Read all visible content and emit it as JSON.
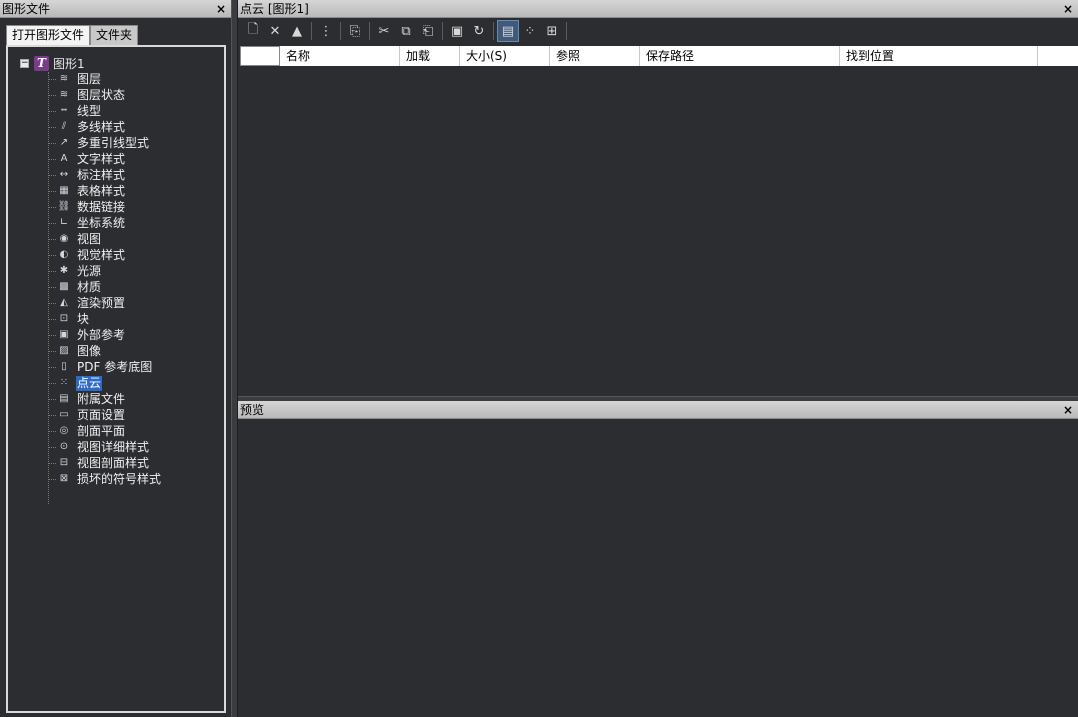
{
  "left_panel": {
    "title": "图形文件",
    "close": "×",
    "tabs": [
      "打开图形文件",
      "文件夹"
    ],
    "tree": {
      "root": {
        "expander": "−",
        "icon": "T",
        "label": "图形1"
      },
      "items": [
        {
          "icon": "layer-icon",
          "glyph": "≋",
          "label": "图层"
        },
        {
          "icon": "layer-state-icon",
          "glyph": "≋",
          "label": "图层状态"
        },
        {
          "icon": "linetype-icon",
          "glyph": "┅",
          "label": "线型"
        },
        {
          "icon": "multiline-style-icon",
          "glyph": "⫽",
          "label": "多线样式"
        },
        {
          "icon": "multileader-style-icon",
          "glyph": "↗",
          "label": "多重引线型式"
        },
        {
          "icon": "text-style-icon",
          "glyph": "A",
          "label": "文字样式"
        },
        {
          "icon": "dimension-style-icon",
          "glyph": "↔",
          "label": "标注样式"
        },
        {
          "icon": "table-style-icon",
          "glyph": "▦",
          "label": "表格样式"
        },
        {
          "icon": "data-link-icon",
          "glyph": "⛓",
          "label": "数据链接"
        },
        {
          "icon": "ucs-icon",
          "glyph": "∟",
          "label": "坐标系统"
        },
        {
          "icon": "view-icon",
          "glyph": "◉",
          "label": "视图"
        },
        {
          "icon": "visual-style-icon",
          "glyph": "◐",
          "label": "视觉样式"
        },
        {
          "icon": "light-icon",
          "glyph": "✱",
          "label": "光源"
        },
        {
          "icon": "material-icon",
          "glyph": "▩",
          "label": "材质"
        },
        {
          "icon": "render-preset-icon",
          "glyph": "◭",
          "label": "渲染预置"
        },
        {
          "icon": "block-icon",
          "glyph": "⊡",
          "label": "块"
        },
        {
          "icon": "xref-icon",
          "glyph": "▣",
          "label": "外部参考"
        },
        {
          "icon": "image-icon",
          "glyph": "▨",
          "label": "图像"
        },
        {
          "icon": "pdf-underlay-icon",
          "glyph": "▯",
          "label": "PDF 参考底图"
        },
        {
          "icon": "point-cloud-icon",
          "glyph": "⁙",
          "label": "点云",
          "selected": true
        },
        {
          "icon": "attached-file-icon",
          "glyph": "▤",
          "label": "附属文件"
        },
        {
          "icon": "page-setup-icon",
          "glyph": "▭",
          "label": "页面设置"
        },
        {
          "icon": "section-plane-icon",
          "glyph": "◎",
          "label": "剖面平面"
        },
        {
          "icon": "detail-view-style-icon",
          "glyph": "⊙",
          "label": "视图详细样式"
        },
        {
          "icon": "section-view-style-icon",
          "glyph": "⊟",
          "label": "视图剖面样式"
        },
        {
          "icon": "broken-symbol-style-icon",
          "glyph": "⊠",
          "label": "损坏的符号样式"
        }
      ]
    }
  },
  "right_panel": {
    "title": "点云 [图形1]",
    "close": "×",
    "toolbar": [
      {
        "name": "new-icon",
        "glyph": "🗋"
      },
      {
        "name": "delete-icon",
        "glyph": "✕"
      },
      {
        "name": "purge-icon",
        "glyph": "▲"
      },
      {
        "sep": true
      },
      {
        "name": "select-icon",
        "glyph": "⋮"
      },
      {
        "sep": true
      },
      {
        "name": "find-icon",
        "glyph": "⎘"
      },
      {
        "sep": true
      },
      {
        "name": "cut-icon",
        "glyph": "✂"
      },
      {
        "name": "copy-icon",
        "glyph": "⧉"
      },
      {
        "name": "paste-icon",
        "glyph": "⎗"
      },
      {
        "sep": true
      },
      {
        "name": "export-icon",
        "glyph": "▣"
      },
      {
        "name": "refresh-icon",
        "glyph": "↻"
      },
      {
        "sep": true
      },
      {
        "name": "list-view-icon",
        "glyph": "▤",
        "active": true
      },
      {
        "name": "icon-view-icon",
        "glyph": "⁘"
      },
      {
        "name": "tree-view-icon",
        "glyph": "⊞"
      },
      {
        "sep": true
      }
    ],
    "columns": [
      "",
      "名称",
      "加载",
      "大小(S)",
      "参照",
      "保存路径",
      "找到位置"
    ],
    "rows": []
  },
  "preview_panel": {
    "title": "预览",
    "close": "×"
  },
  "colors": {
    "background": "#2b2d31",
    "selection": "#2e6bc6",
    "titlebar": "#c8c8c8"
  }
}
